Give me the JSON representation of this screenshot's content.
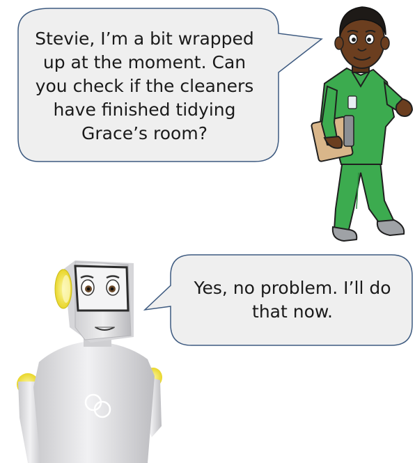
{
  "dialogue": {
    "nurse_line": "Stevie, I’m a bit wrapped\nup at the moment. Can\nyou check if the cleaners\nhave finished tidying\nGrace’s room?",
    "robot_line": "Yes, no problem. I’ll do\nthat now."
  },
  "colors": {
    "bubble_fill": "#efefef",
    "bubble_stroke": "#3d5a80",
    "scrubs": "#3cab4f",
    "robot_body": "#e4e4e6",
    "robot_accent": "#f2e33a"
  },
  "icons": {
    "nurse": "nurse-character-icon",
    "robot": "stevie-robot-icon"
  }
}
